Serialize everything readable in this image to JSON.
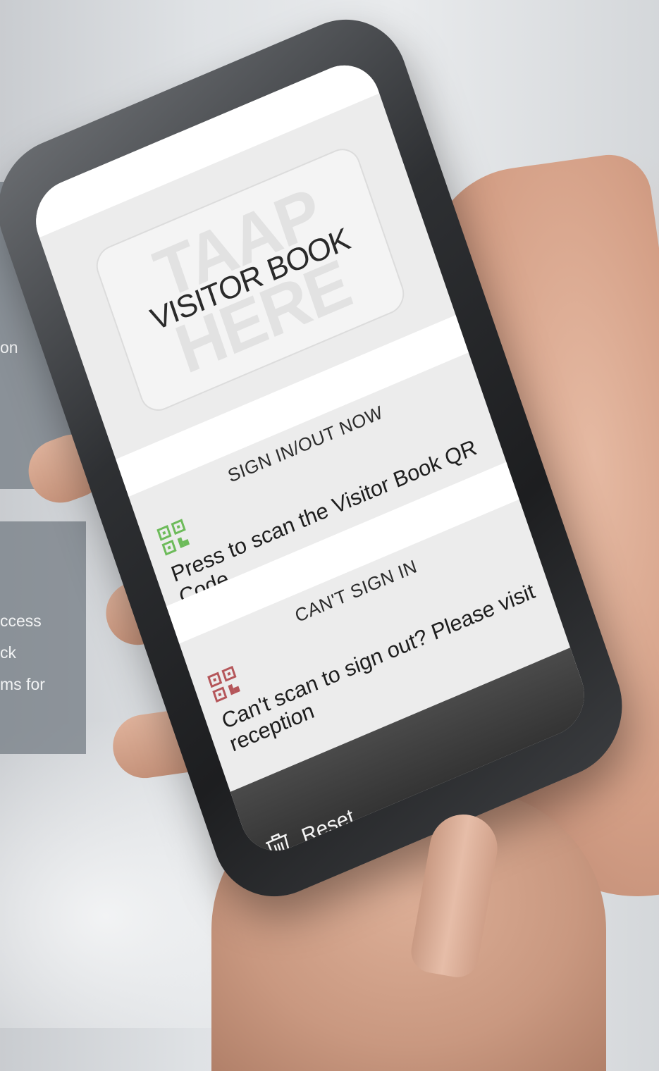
{
  "background_panels": {
    "panel_top": {
      "fragment": "on"
    },
    "panel_bottom": {
      "fragments": [
        "ccess",
        "ck",
        "ms for"
      ]
    }
  },
  "app": {
    "logo": {
      "big_word_top": "TAAP",
      "main_text": "VISITOR BOOK",
      "big_word_bottom": "HERE"
    },
    "sign_in_section": {
      "title": "SIGN IN/OUT NOW",
      "text": "Press to scan the Visitor Book QR Code",
      "icon": "qr-code-icon",
      "icon_color": "#6dbb5a"
    },
    "cant_sign_in_section": {
      "title": "CAN'T SIGN IN",
      "text": "Can't scan to sign out? Please visit reception",
      "icon": "qr-code-icon",
      "icon_color": "#b5565a"
    },
    "bottom_bar": {
      "reset_label": "Reset",
      "reset_icon": "trash-icon"
    }
  },
  "colors": {
    "screen_background": "#ececec",
    "bottom_bar": "#2f2f2f",
    "panel_overlay": "#78808a"
  }
}
